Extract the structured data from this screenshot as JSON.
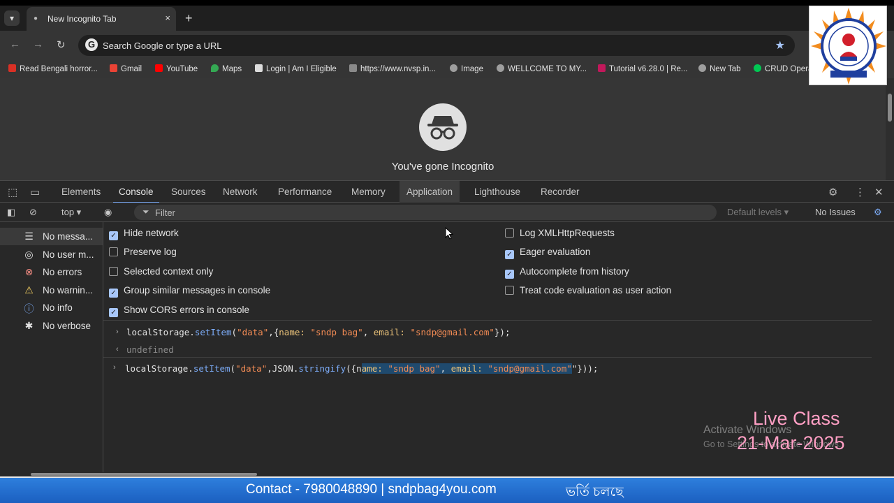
{
  "browser": {
    "tab_title": "New Incognito Tab",
    "tab_close": "×",
    "new_tab": "+",
    "omnibox_placeholder": "Search Google or type a URL",
    "bookmarks": [
      {
        "label": "Read Bengali horror...",
        "color": "#d93025"
      },
      {
        "label": "Gmail",
        "color": "#ea4335"
      },
      {
        "label": "YouTube",
        "color": "#ff0000"
      },
      {
        "label": "Maps",
        "color": "#34a853"
      },
      {
        "label": "Login | Am I Eligible",
        "color": "#dddddd"
      },
      {
        "label": "https://www.nvsp.in...",
        "color": "#bbbbbb"
      },
      {
        "label": "Image",
        "color": "#bbbbbb"
      },
      {
        "label": "WELLCOME TO MY...",
        "color": "#bbbbbb"
      },
      {
        "label": "Tutorial v6.28.0 | Re...",
        "color": "#c2185b"
      },
      {
        "label": "New Tab",
        "color": "#bbbbbb"
      },
      {
        "label": "CRUD Opera",
        "color": "#00c853"
      }
    ],
    "incognito_message": "You've gone Incognito"
  },
  "devtools": {
    "tabs": [
      "Elements",
      "Console",
      "Sources",
      "Network",
      "Performance",
      "Memory",
      "Application",
      "Lighthouse",
      "Recorder"
    ],
    "active_tab": "Console",
    "context": "top ▾",
    "filter_placeholder": "Filter",
    "default_levels": "Default levels ▾",
    "issues": "No Issues"
  },
  "sidebar": {
    "items": [
      {
        "label": "No messa...",
        "icon": "list-icon"
      },
      {
        "label": "No user m...",
        "icon": "user-icon"
      },
      {
        "label": "No errors",
        "icon": "error-icon"
      },
      {
        "label": "No warnin...",
        "icon": "warning-icon"
      },
      {
        "label": "No info",
        "icon": "info-icon"
      },
      {
        "label": "No verbose",
        "icon": "bug-icon"
      }
    ]
  },
  "settings": {
    "left": [
      {
        "label": "Hide network",
        "checked": true
      },
      {
        "label": "Preserve log",
        "checked": false
      },
      {
        "label": "Selected context only",
        "checked": false
      },
      {
        "label": "Group similar messages in console",
        "checked": true
      },
      {
        "label": "Show CORS errors in console",
        "checked": true
      }
    ],
    "right": [
      {
        "label": "Log XMLHttpRequests",
        "checked": false
      },
      {
        "label": "Eager evaluation",
        "checked": true
      },
      {
        "label": "Autocomplete from history",
        "checked": true
      },
      {
        "label": "Treat code evaluation as user action",
        "checked": false
      }
    ]
  },
  "console": {
    "line1": {
      "obj": "localStorage.",
      "fn": "setItem",
      "open": "(",
      "s1": "\"data\"",
      "mid": ",{",
      "k1": "name:",
      "sp1": " ",
      "v1": "\"sndp bag\"",
      "comma": ", ",
      "k2": "email:",
      "sp2": " ",
      "v2": "\"sndp@gmail.com\"",
      "end": "});"
    },
    "result": "undefined",
    "line2": {
      "obj": "localStorage.",
      "fn": "setItem",
      "open": "(",
      "s1": "\"data\"",
      "mid": ",JSON.",
      "fn2": "stringify",
      "open2": "({n",
      "k1": "ame:",
      "sp1": " ",
      "v1": "\"sndp bag\"",
      "comma": ", ",
      "k2": "email:",
      "sp2": " ",
      "v2": "\"sndp@gmail.com\"",
      "end": "\"}));"
    }
  },
  "overlay": {
    "activate_title": "Activate Windows",
    "activate_sub": "Go to Settings to activate Windows.",
    "live_class": "Live Class",
    "date": "21-Mar-2025",
    "contact": "Contact - 7980048890 | sndpbag4you.com",
    "bengali": "ভর্তি চলছে"
  }
}
